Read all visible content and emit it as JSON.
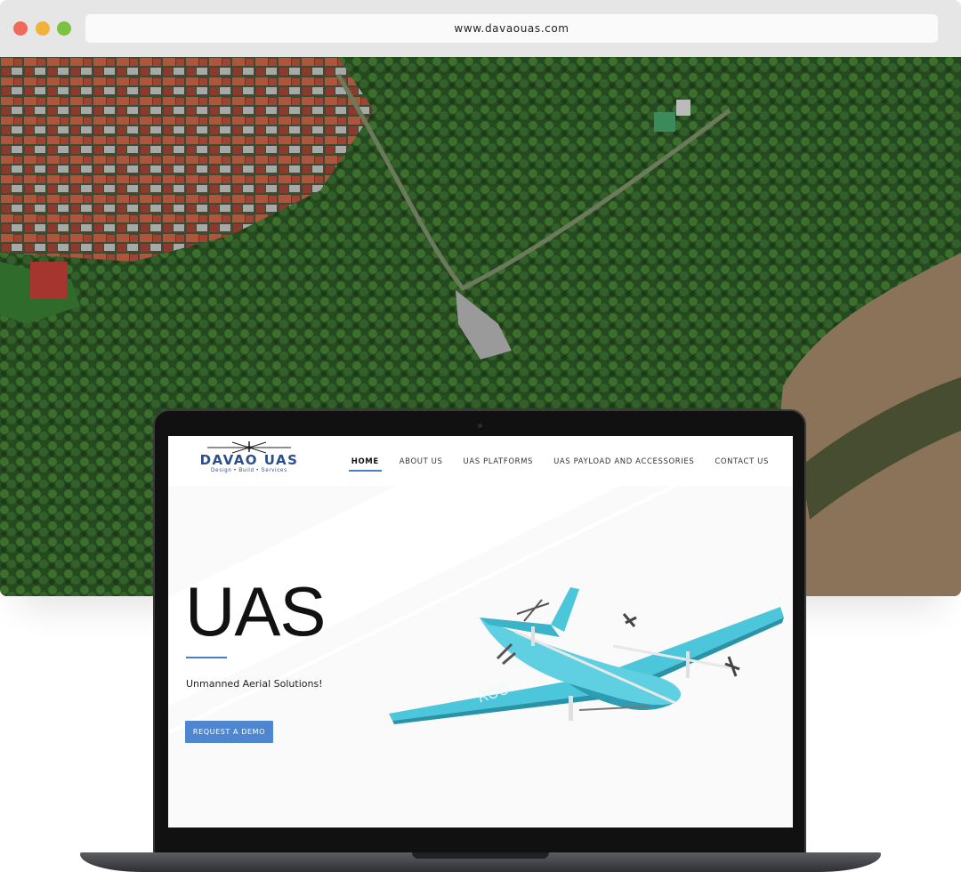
{
  "browser": {
    "url": "www.davaouas.com"
  },
  "site": {
    "logo": {
      "name": "DAVAO UAS",
      "tagline": "Design • Build • Services"
    },
    "nav": [
      {
        "label": "HOME",
        "active": true
      },
      {
        "label": "ABOUT US",
        "active": false
      },
      {
        "label": "UAS PLATFORMS",
        "active": false
      },
      {
        "label": "UAS PAYLOAD AND ACCESSORIES",
        "active": false
      },
      {
        "label": "CONTACT US",
        "active": false
      }
    ],
    "hero": {
      "title": "UAS",
      "subtitle": "Unmanned Aerial Solutions!",
      "cta_label": "REQUEST A DEMO"
    },
    "drone_marking": "ROO"
  },
  "colors": {
    "accent": "#4f86d0",
    "logo_blue": "#2b4f8c",
    "drone": "#4cc6da"
  }
}
